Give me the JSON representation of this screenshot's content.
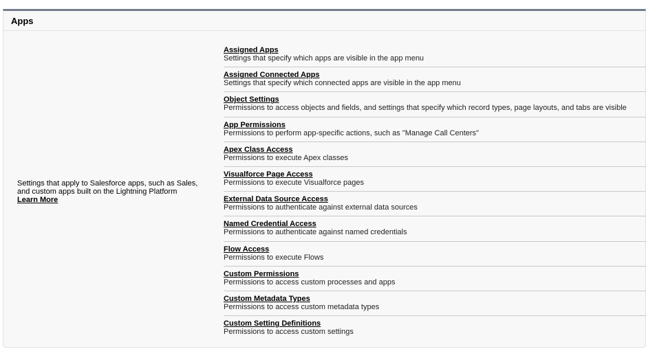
{
  "section": {
    "title": "Apps",
    "description": "Settings that apply to Salesforce apps, such as Sales, and custom apps built on the Lightning Platform",
    "learn_more": "Learn More"
  },
  "items": [
    {
      "label": "Assigned Apps",
      "description": "Settings that specify which apps are visible in the app menu"
    },
    {
      "label": "Assigned Connected Apps",
      "description": "Settings that specify which connected apps are visible in the app menu"
    },
    {
      "label": "Object Settings",
      "description": "Permissions to access objects and fields, and settings that specify which record types, page layouts, and tabs are visible"
    },
    {
      "label": "App Permissions",
      "description": "Permissions to perform app-specific actions, such as \"Manage Call Centers\""
    },
    {
      "label": "Apex Class Access",
      "description": "Permissions to execute Apex classes"
    },
    {
      "label": "Visualforce Page Access",
      "description": "Permissions to execute Visualforce pages"
    },
    {
      "label": "External Data Source Access",
      "description": "Permissions to authenticate against external data sources"
    },
    {
      "label": "Named Credential Access",
      "description": "Permissions to authenticate against named credentials"
    },
    {
      "label": "Flow Access",
      "description": "Permissions to execute Flows"
    },
    {
      "label": "Custom Permissions",
      "description": "Permissions to access custom processes and apps"
    },
    {
      "label": "Custom Metadata Types",
      "description": "Permissions to access custom metadata types"
    },
    {
      "label": "Custom Setting Definitions",
      "description": "Permissions to access custom settings"
    }
  ]
}
